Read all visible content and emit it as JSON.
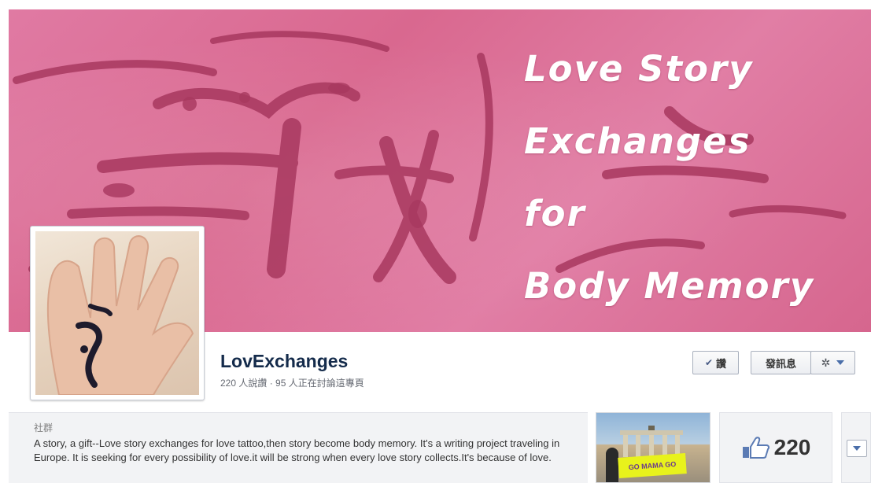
{
  "cover": {
    "title": "Love Story\nExchanges\nfor\nBody Memory"
  },
  "page": {
    "name": "LovExchanges",
    "stats": "220 人說讚 · 95 人正在討論這專頁"
  },
  "actions": {
    "like_label": "讚",
    "message_label": "發訊息"
  },
  "about": {
    "category": "社群",
    "description": "A story, a gift--Love story exchanges for love tattoo,then story become body memory. It's a writing project traveling in Europe. It is seeking for every possibility of love.it will be strong when every love story collects.It's because of love."
  },
  "photo": {
    "banner_text": "GO MAMA GO"
  },
  "likes": {
    "count": "220"
  },
  "colors": {
    "cover_pink": "#d9688f",
    "brush_stroke": "#a8385f",
    "name_blue": "#142b4b",
    "caret_blue": "#4a6ea9"
  },
  "icons": [
    "check-icon",
    "gear-icon",
    "chevron-down-icon",
    "thumbs-up-icon"
  ]
}
